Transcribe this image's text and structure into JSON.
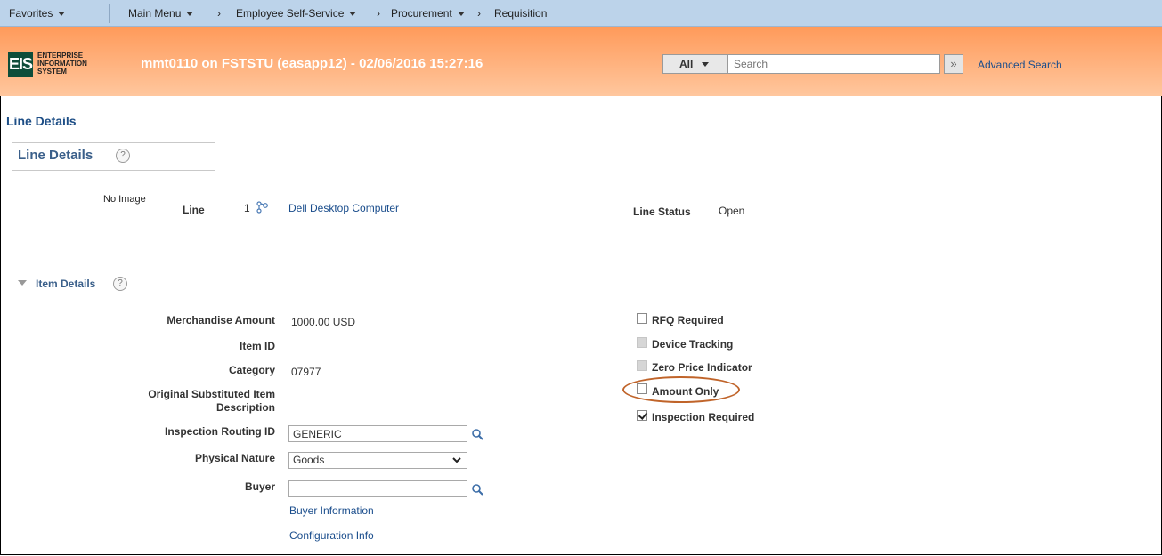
{
  "nav": {
    "favorites": "Favorites",
    "main_menu": "Main Menu",
    "breadcrumb": [
      "Employee Self-Service",
      "Procurement",
      "Requisition"
    ]
  },
  "banner": {
    "logo_letters": "EIS",
    "logo_lines": [
      "ENTERPRISE",
      "INFORMATION",
      "SYSTEM"
    ],
    "title": "mmt0110 on FSTSTU (easapp12) - 02/06/2016 15:27:16",
    "search_scope": "All",
    "search_placeholder": "Search",
    "advanced_search": "Advanced Search"
  },
  "page": {
    "title": "Line Details",
    "subtitle": "Line Details",
    "no_image": "No Image",
    "line_label": "Line",
    "line_number": "1",
    "line_description": "Dell Desktop Computer",
    "line_status_label": "Line Status",
    "line_status_value": "Open"
  },
  "item_details": {
    "section_title": "Item Details",
    "merchandise_amount_label": "Merchandise Amount",
    "merchandise_amount_value": "1000.00 USD",
    "item_id_label": "Item ID",
    "category_label": "Category",
    "category_value": "07977",
    "orig_sub_label_1": "Original Substituted Item",
    "orig_sub_label_2": "Description",
    "inspection_routing_label": "Inspection Routing ID",
    "inspection_routing_value": "GENERIC",
    "physical_nature_label": "Physical Nature",
    "physical_nature_value": "Goods",
    "buyer_label": "Buyer",
    "buyer_value": "",
    "buyer_information_link": "Buyer Information",
    "configuration_info_link": "Configuration Info"
  },
  "checkboxes": [
    {
      "label": "RFQ Required",
      "checked": false,
      "disabled": false
    },
    {
      "label": "Device Tracking",
      "checked": false,
      "disabled": true
    },
    {
      "label": "Zero Price Indicator",
      "checked": false,
      "disabled": true
    },
    {
      "label": "Amount Only",
      "checked": false,
      "disabled": false
    },
    {
      "label": "Inspection Required",
      "checked": true,
      "disabled": false
    }
  ],
  "colors": {
    "banner_orange": "#ff9a5a",
    "link_blue": "#1a4d8c",
    "highlight_circle": "#c0642a"
  }
}
